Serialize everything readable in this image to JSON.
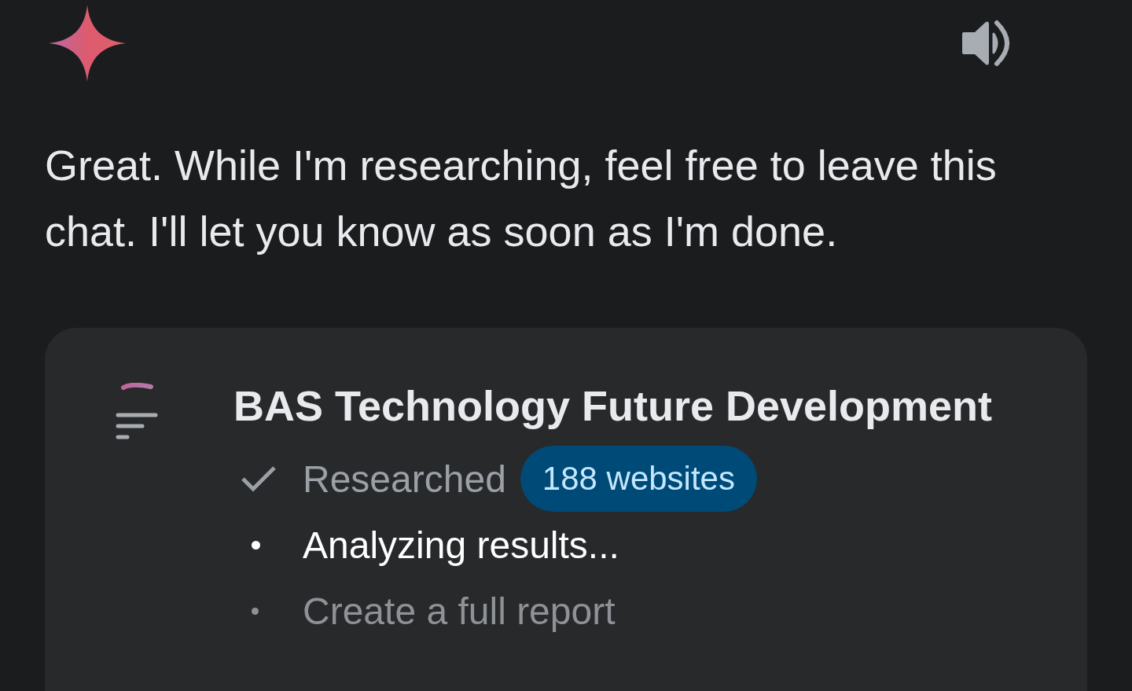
{
  "message": "Great. While I'm researching, feel free to leave this chat. I'll let you know as soon as I'm done.",
  "research_card": {
    "title": "BAS Technology Future Development",
    "steps": [
      {
        "label": "Researched",
        "kind": "done",
        "badge": "188 websites"
      },
      {
        "label": "Analyzing results...",
        "kind": "active"
      },
      {
        "label": "Create a full report",
        "kind": "pending"
      }
    ]
  }
}
